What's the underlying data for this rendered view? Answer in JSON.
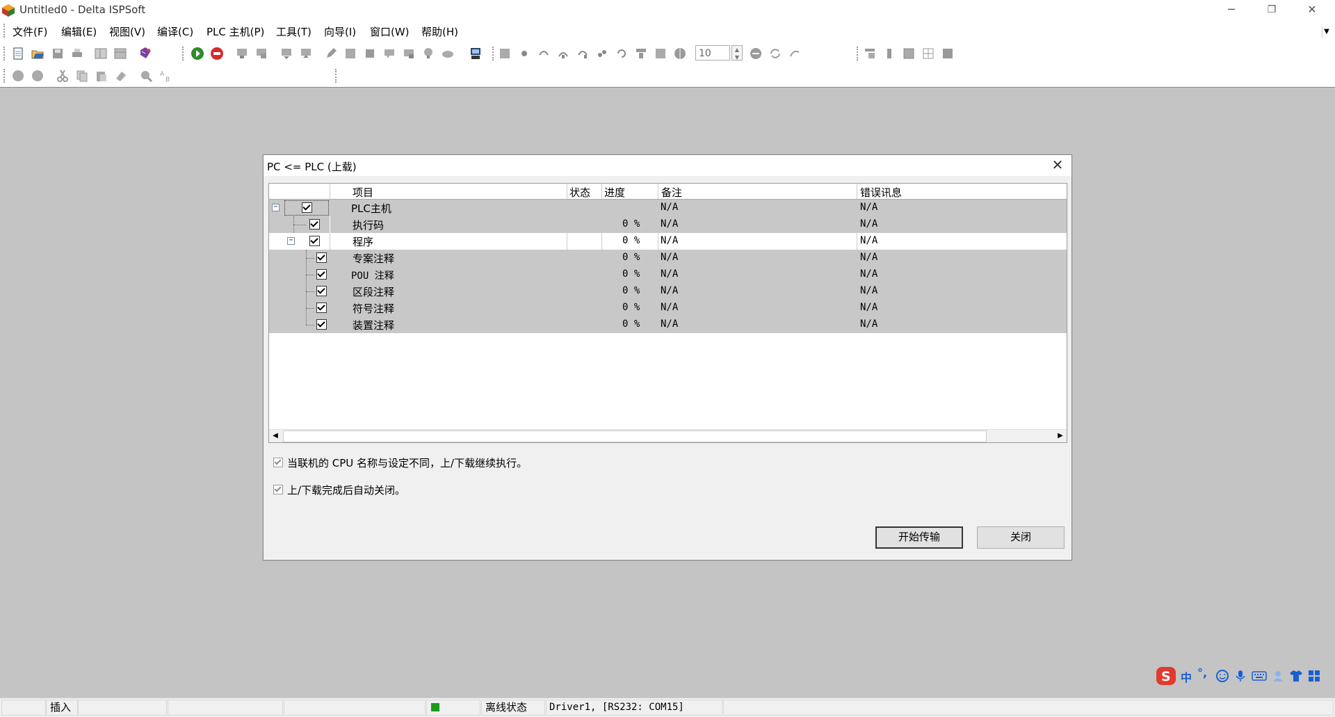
{
  "window": {
    "title": "Untitled0 - Delta ISPSoft",
    "minimize": "─",
    "restore": "❐",
    "close": "✕"
  },
  "menu": {
    "items": [
      "文件(F)",
      "编辑(E)",
      "视图(V)",
      "编译(C)",
      "PLC 主机(P)",
      "工具(T)",
      "向导(I)",
      "窗口(W)",
      "帮助(H)"
    ]
  },
  "toolbar": {
    "zoom_value": "10"
  },
  "dialog": {
    "title": "PC <= PLC (上载)",
    "close": "✕",
    "columns": {
      "item": "项目",
      "status": "状态",
      "progress": "进度",
      "note": "备注",
      "error": "错误讯息"
    },
    "rows": [
      {
        "label": "PLC主机",
        "progress": "",
        "note": "N/A",
        "error": "N/A"
      },
      {
        "label": "执行码",
        "progress": "0 %",
        "note": "N/A",
        "error": "N/A"
      },
      {
        "label": "程序",
        "progress": "0 %",
        "note": "N/A",
        "error": "N/A"
      },
      {
        "label": "专案注释",
        "progress": "0 %",
        "note": "N/A",
        "error": "N/A"
      },
      {
        "label": "POU 注释",
        "progress": "0 %",
        "note": "N/A",
        "error": "N/A"
      },
      {
        "label": "区段注释",
        "progress": "0 %",
        "note": "N/A",
        "error": "N/A"
      },
      {
        "label": "符号注释",
        "progress": "0 %",
        "note": "N/A",
        "error": "N/A"
      },
      {
        "label": "装置注释",
        "progress": "0 %",
        "note": "N/A",
        "error": "N/A"
      }
    ],
    "option1": "当联机的 CPU 名称与设定不同，上/下载继续执行。",
    "option2": "上/下载完成后自动关闭。",
    "start_button": "开始传输",
    "close_button": "关闭"
  },
  "statusbar": {
    "mode": "插入",
    "connection": "离线状态",
    "driver": "Driver1, [RS232: COM15]"
  },
  "ime": {
    "lang": "中",
    "punct": "°,"
  },
  "colors": {
    "workspace": "#c4c4c4",
    "row_gray": "#c8c8c8",
    "status_green": "#1a9b1a",
    "ime_red": "#e23a2e"
  }
}
